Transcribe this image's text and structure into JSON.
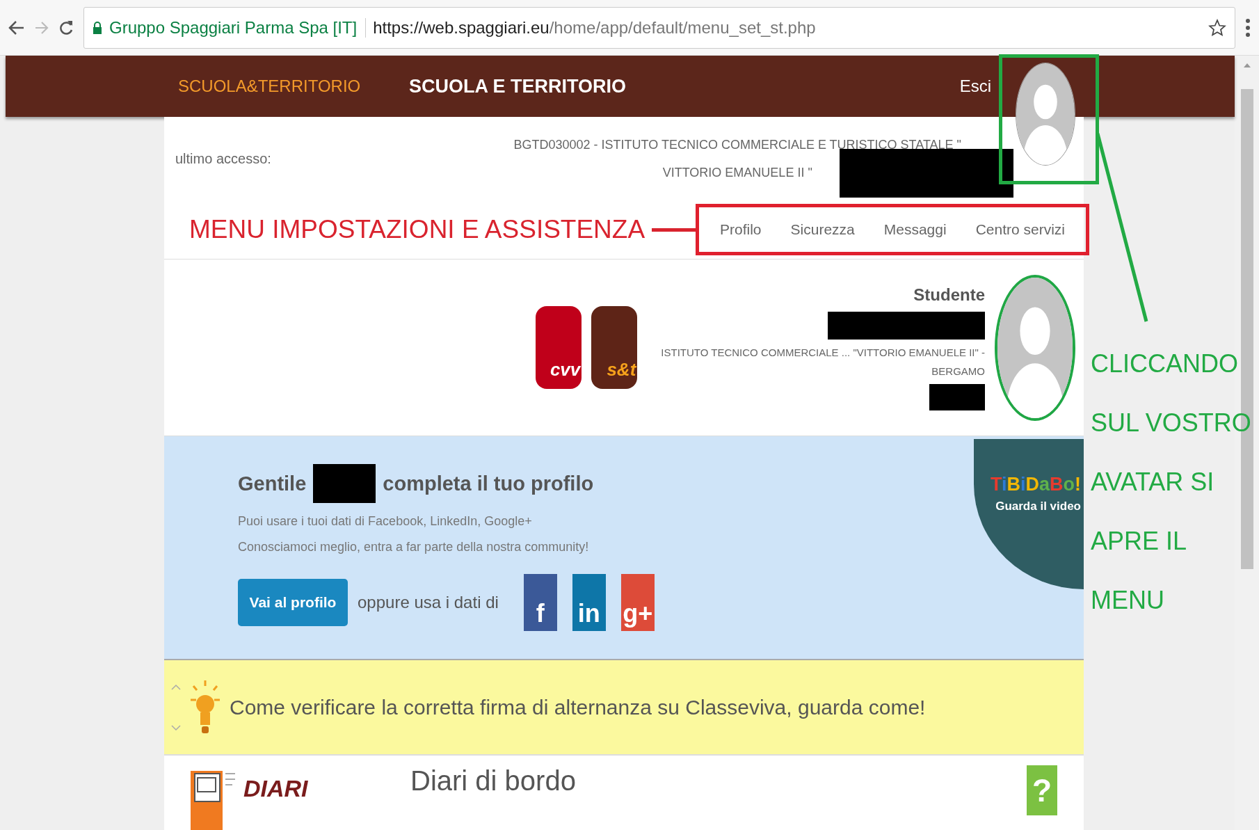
{
  "browser": {
    "site_identity": "Gruppo Spaggiari Parma Spa [IT]",
    "url_host": "https://web.spaggiari.eu",
    "url_path": "/home/app/default/menu_set_st.php"
  },
  "header": {
    "logo": "SCUOLA&TERRITORIO",
    "title": "SCUOLA E TERRITORIO",
    "logout": "Esci"
  },
  "account": {
    "last_access": "ultimo accesso:",
    "school_lines": [
      "BGTD030002 - ISTITUTO TECNICO COMMERCIALE E TURISTICO STATALE \"",
      "VITTORIO EMANUELE II \""
    ]
  },
  "menu": [
    {
      "label": "Profilo"
    },
    {
      "label": "Sicurezza"
    },
    {
      "label": "Messaggi"
    },
    {
      "label": "Centro servizi"
    }
  ],
  "profile": {
    "apps": [
      {
        "kind": "cvv",
        "label": "cvv"
      },
      {
        "kind": "st",
        "label": "s&t"
      }
    ],
    "role": "Studente",
    "school": "ISTITUTO TECNICO COMMERCIALE ... \"VITTORIO EMANUELE II\" -",
    "city": "BERGAMO"
  },
  "banner": {
    "greeting": "Gentile",
    "heading_rest": "completa il tuo profilo",
    "lines": [
      "Puoi usare i tuoi dati di Facebook, LinkedIn, Google+",
      "Conosciamoci meglio, entra a far parte della nostra community!"
    ],
    "button": "Vai al profilo",
    "alt_text": "oppure usa i dati di",
    "social": [
      {
        "kind": "facebook",
        "label": "f"
      },
      {
        "kind": "linkedin",
        "label": "in"
      },
      {
        "kind": "googleplus",
        "label": "g+"
      }
    ],
    "video_badge": {
      "brand": "TiBiDaBo!",
      "caption": "Guarda il video"
    }
  },
  "notice": {
    "text": "Come verificare la corretta firma di alternanza su Classeviva, guarda come!"
  },
  "section": {
    "icon_label": "DIARI",
    "title": "Diari di bordo",
    "help": "?"
  },
  "annotations": {
    "menu_label": "MENU IMPOSTAZIONI E ASSISTENZA",
    "avatar_note": [
      "CLICCANDO",
      "SUL VOSTRO",
      "AVATAR SI",
      "APRE IL",
      "MENU"
    ]
  }
}
